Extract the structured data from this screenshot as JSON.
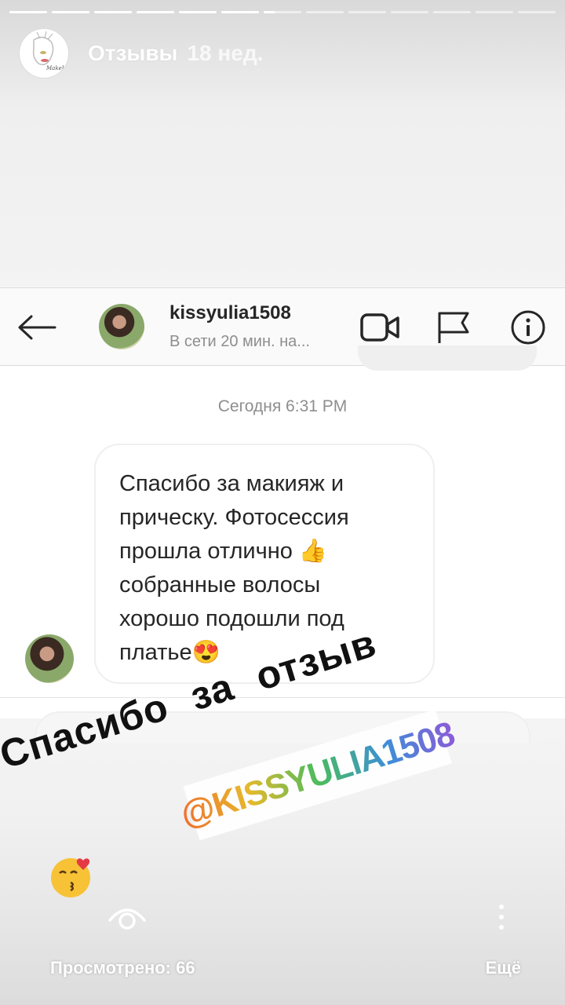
{
  "story": {
    "title": "Отзывы",
    "time_ago": "18 нед.",
    "progress": {
      "segments": 13,
      "current_segment": 7,
      "current_fill": 0.3
    }
  },
  "chat": {
    "username": "kissyulia1508",
    "status": "В сети 20 мин. на...",
    "timestamp": "Сегодня 6:31 PM",
    "message": "Спасибо за макияж и\nприческу. Фотосессия\nпрошла отлично 👍\nсобранные волосы\nхорошо подошли под\nплатье😍"
  },
  "stickers": {
    "thanks": "Спасибо за отзыв",
    "mention": "@KISSYULIA1508",
    "emoji": "😘"
  },
  "footer": {
    "viewed": "Просмотрено: 66",
    "more": "Ещё"
  },
  "icons": {
    "back": "arrow-left-icon",
    "video": "video-camera-icon",
    "flag": "flag-icon",
    "info": "info-icon",
    "viewers": "eye-icon",
    "more": "vertical-dots-icon"
  }
}
